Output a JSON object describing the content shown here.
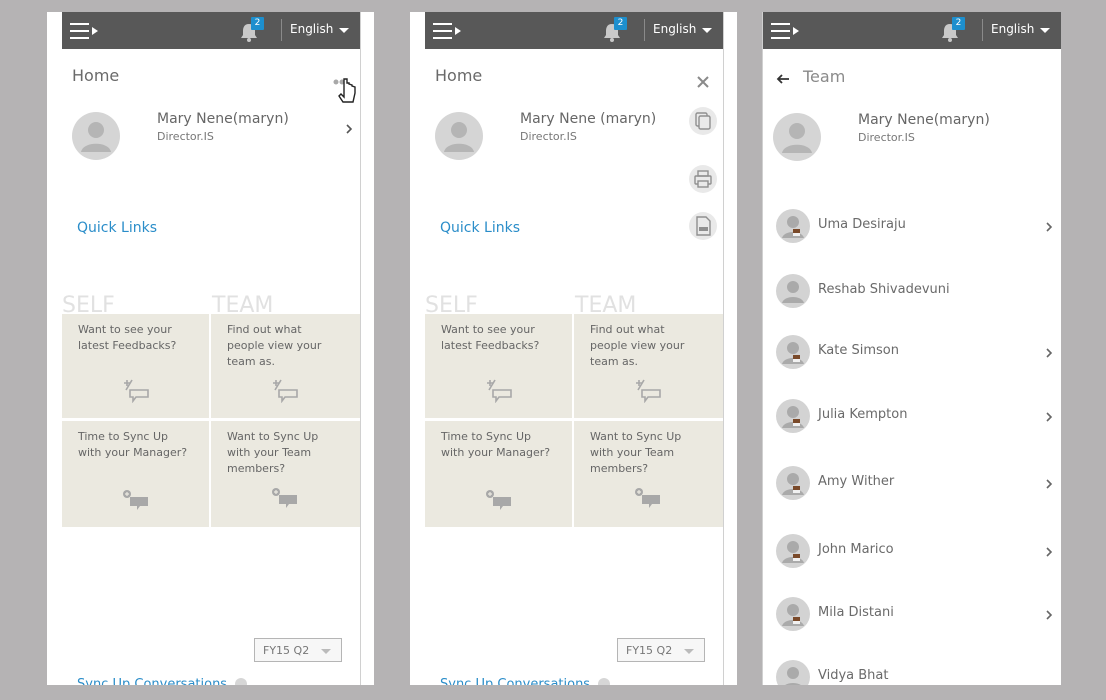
{
  "header": {
    "notification_count": "2",
    "language": "English"
  },
  "home": {
    "title": "Home",
    "profile_name_1": "Mary Nene(maryn)",
    "profile_name_2": "Mary Nene (maryn)",
    "profile_role": "Director.IS",
    "quick_links": "Quick Links",
    "self_label": "SELF",
    "team_label": "TEAM",
    "tiles": [
      {
        "text": "Want to see your latest Feedbacks?"
      },
      {
        "text": "Find out what people view your team as."
      },
      {
        "text": "Time to Sync Up with your Manager?"
      },
      {
        "text": "Want to Sync Up with your Team members?"
      }
    ],
    "period_select": "FY15 Q2",
    "sync_conversations": "Sync Up Conversations"
  },
  "team": {
    "title": "Team",
    "profile_name": "Mary Nene(maryn)",
    "profile_role": "Director.IS",
    "members": [
      {
        "name": "Uma Desiraju",
        "has_chevron": true
      },
      {
        "name": "Reshab Shivadevuni",
        "has_chevron": false
      },
      {
        "name": "Kate Simson",
        "has_chevron": true
      },
      {
        "name": "Julia Kempton",
        "has_chevron": true
      },
      {
        "name": "Amy Wither",
        "has_chevron": true
      },
      {
        "name": "John Marico",
        "has_chevron": true
      },
      {
        "name": "Mila Distani",
        "has_chevron": true
      },
      {
        "name": "Vidya Bhat",
        "has_chevron": false
      }
    ]
  },
  "icons": {
    "menu": "menu-icon",
    "bell": "bell-icon",
    "more": "more-dots-icon",
    "close": "close-icon",
    "copy": "copy-icon",
    "print": "print-icon",
    "export": "document-export-icon",
    "back": "back-arrow-icon",
    "chevron": "chevron-right-icon"
  },
  "colors": {
    "topbar": "#585858",
    "badge": "#1d8fce",
    "link": "#2a8dc9",
    "tile": "#ebe9e0",
    "backdrop": "#b5b3b4"
  }
}
